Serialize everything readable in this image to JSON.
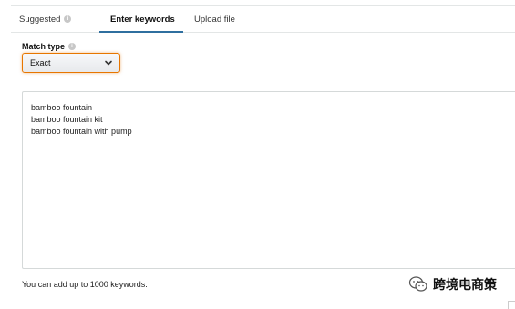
{
  "tabs": [
    {
      "label": "Suggested",
      "has_info_icon": true,
      "active": false
    },
    {
      "label": "Enter keywords",
      "has_info_icon": false,
      "active": true
    },
    {
      "label": "Upload file",
      "has_info_icon": false,
      "active": false
    }
  ],
  "match_type": {
    "label": "Match type",
    "has_info_icon": true,
    "selected": "Exact",
    "icon": "chevron-down-icon"
  },
  "keywords": {
    "lines": [
      "bamboo fountain",
      "bamboo fountain kit",
      "bamboo fountain with pump"
    ]
  },
  "hint": "You can add up to 1000 keywords.",
  "watermark": {
    "text": "跨境电商策",
    "icon": "wechat-logo-icon"
  },
  "colors": {
    "active_tab_underline": "#2f6f9f",
    "dropdown_focus_border": "#e77600",
    "border": "#d5d9d9"
  }
}
